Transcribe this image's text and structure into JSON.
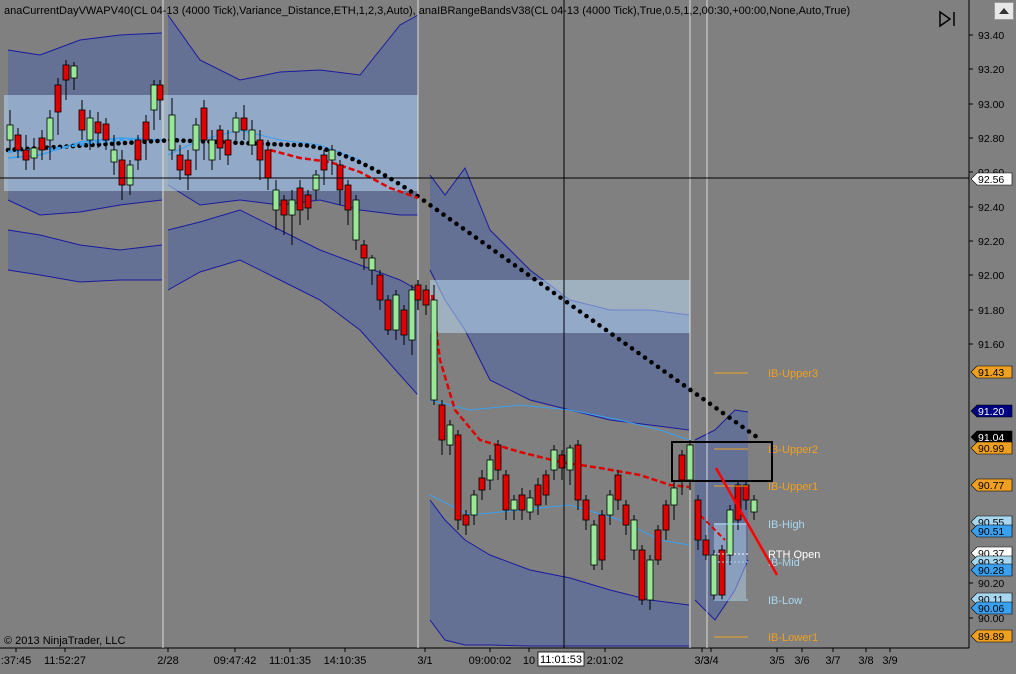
{
  "header": {
    "title": "anaCurrentDayVWAPV40(CL 04-13 (4000 Tick),Variance_Distance,ETH,1,2,3,Auto), anaIBRangeBandsV38(CL 04-13 (4000 Tick),True,0.5,1,2,00:30,+00:00,None,Auto,True)"
  },
  "footer": {
    "copyright": "© 2013 NinjaTrader, LLC"
  },
  "chart_data": {
    "type": "candlestick",
    "ylim": [
      89.8,
      93.5
    ],
    "y_ticks": [
      "93.40",
      "93.20",
      "93.00",
      "92.80",
      "92.60",
      "92.40",
      "92.20",
      "92.00",
      "91.80",
      "91.60",
      "90.20",
      "90.00"
    ],
    "x_labels": [
      ":37:45",
      "11:52:27",
      "2/28",
      "09:47:42",
      "11:01:35",
      "14:10:35",
      "3/1",
      "09:00:02",
      "10",
      "2:01:02",
      "3/3",
      "3/4",
      "3/5",
      "3/6",
      "3/7",
      "3/8",
      "3/9"
    ],
    "crosshair": {
      "price": "92.56",
      "time": "11:01:53"
    },
    "price_markers": [
      {
        "value": "92.56",
        "bg": "#ffffff",
        "fg": "#000000"
      },
      {
        "value": "91.43",
        "bg": "#f0a020",
        "fg": "#000000"
      },
      {
        "value": "91.20",
        "bg": "#000080",
        "fg": "#ffffff"
      },
      {
        "value": "91.04",
        "bg": "#000000",
        "fg": "#ffffff"
      },
      {
        "value": "90.99",
        "bg": "#f0a020",
        "fg": "#000000"
      },
      {
        "value": "90.77",
        "bg": "#f0a020",
        "fg": "#000000"
      },
      {
        "value": "90.55",
        "bg": "#a8d8f0",
        "fg": "#000000"
      },
      {
        "value": "90.51",
        "bg": "#3aa0f0",
        "fg": "#000000"
      },
      {
        "value": "90.37",
        "bg": "#ffffff",
        "fg": "#000000"
      },
      {
        "value": "90.33",
        "bg": "#a8d8f0",
        "fg": "#000000"
      },
      {
        "value": "90.28",
        "bg": "#3aa0f0",
        "fg": "#000000"
      },
      {
        "value": "90.11",
        "bg": "#a8d8f0",
        "fg": "#000000"
      },
      {
        "value": "90.06",
        "bg": "#3aa0f0",
        "fg": "#000000"
      },
      {
        "value": "89.89",
        "bg": "#f0a020",
        "fg": "#000000"
      }
    ],
    "ib_levels": [
      {
        "name": "IB-Upper3",
        "value": 91.43,
        "color": "#f0a020"
      },
      {
        "name": "IB-Upper2",
        "value": 90.99,
        "color": "#f0a020"
      },
      {
        "name": "IB-Upper1",
        "value": 90.77,
        "color": "#f0a020"
      },
      {
        "name": "IB-High",
        "value": 90.55,
        "color": "#a8d8f0"
      },
      {
        "name": "IB-Mid",
        "value": 90.33,
        "color": "#a8d8f0"
      },
      {
        "name": "IB-Low",
        "value": 90.11,
        "color": "#a8d8f0"
      },
      {
        "name": "IB-Lower1",
        "value": 89.89,
        "color": "#f0a020"
      }
    ],
    "rth_open": {
      "label": "RTH Open",
      "value": 90.37
    },
    "colors": {
      "up": "#98e898",
      "down": "#e00000",
      "vwap": "#e00000",
      "vwap_dots": "#000000",
      "band_fill": "#5f6f98",
      "band_line": "#1a1aa0",
      "inner_band": "#3aa0f0",
      "ib_fill": "#b8d8f0"
    }
  }
}
